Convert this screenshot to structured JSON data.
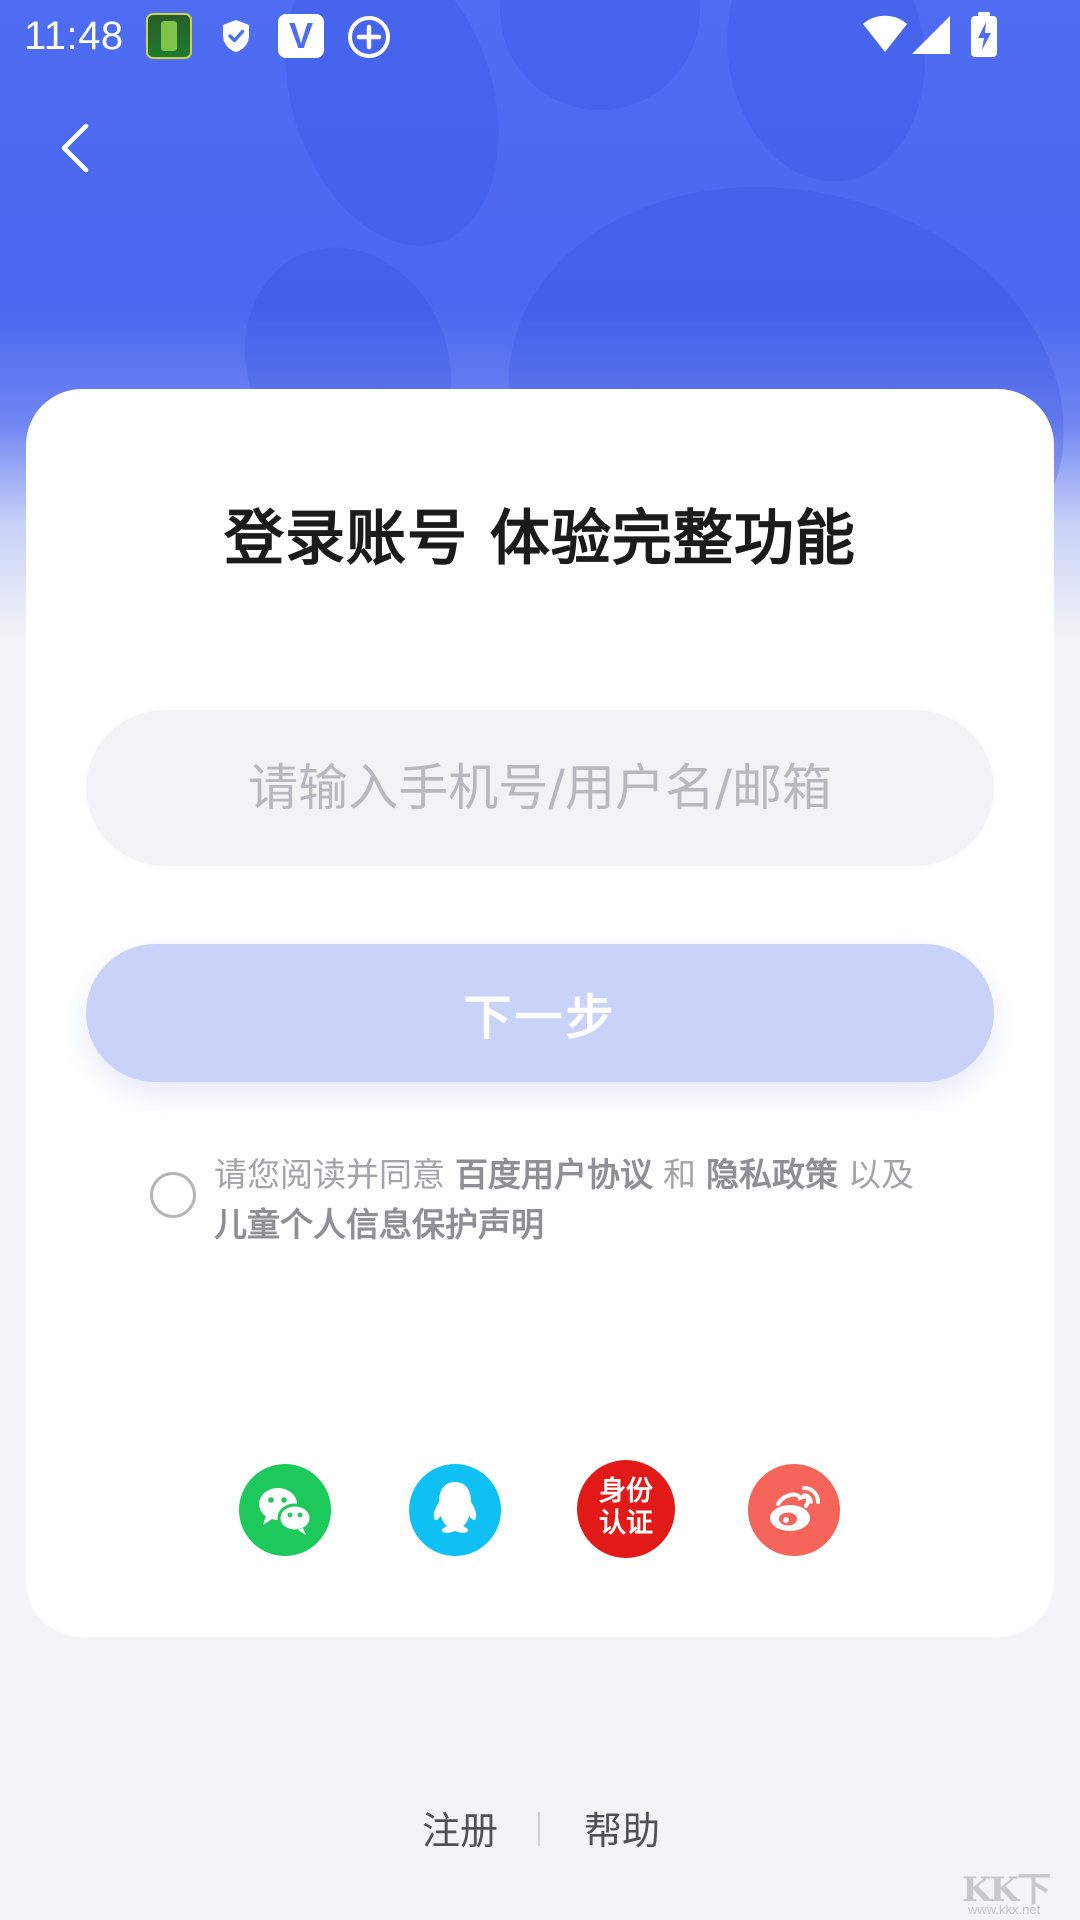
{
  "status_bar": {
    "time": "11:48",
    "icons": [
      "app-battery-icon",
      "shield-icon",
      "v-app-icon",
      "plus-circle-icon",
      "wifi-icon",
      "signal-icon",
      "battery-charging-icon"
    ],
    "v_app_letter": "V"
  },
  "nav": {
    "back_icon": "chevron-left-icon"
  },
  "colors": {
    "brand_blue": "#4f6df2",
    "button_disabled": "#c9d3f9",
    "wechat": "#1ec95b",
    "qq": "#0fc0f2",
    "id_auth": "#e21a17",
    "weibo": "#f4645a"
  },
  "login": {
    "title": "登录账号 体验完整功能",
    "account_input": {
      "value": "",
      "placeholder": "请输入手机号/用户名/邮箱"
    },
    "next_label": "下一步",
    "agreement": {
      "checked": false,
      "prefix": "请您阅读并同意",
      "baidu_agreement": "百度用户协议",
      "and": "和",
      "privacy_policy": "隐私政策",
      "also": "以及",
      "child_privacy": "儿童个人信息保护声明"
    }
  },
  "social_login": {
    "wechat_icon": "wechat-icon",
    "qq_icon": "qq-icon",
    "id_auth_label_line1": "身份",
    "id_auth_label_line2": "认证",
    "weibo_icon": "weibo-icon"
  },
  "footer": {
    "register_label": "注册",
    "help_label": "帮助"
  },
  "watermark": {
    "text": "KK下载",
    "url": "www.kkx.net"
  }
}
